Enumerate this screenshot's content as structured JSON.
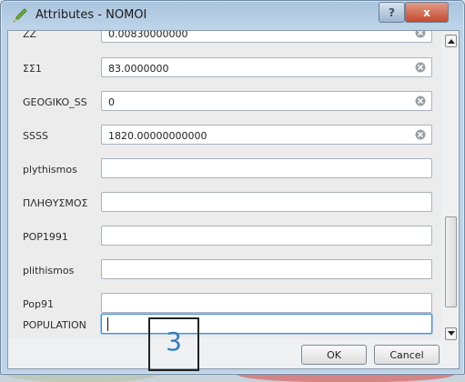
{
  "window": {
    "title": "Attributes - NOMOI",
    "help_glyph": "?",
    "close_glyph": "x"
  },
  "form": {
    "fields": [
      {
        "label": "ZZ",
        "value": "0.00830000000",
        "clear_icon": true
      },
      {
        "label": "ΣΣ1",
        "value": "83.0000000",
        "clear_icon": true
      },
      {
        "label": "GEOGIKO_SS",
        "value": "0",
        "clear_icon": true
      },
      {
        "label": "SSSS",
        "value": "1820.00000000000",
        "clear_icon": true
      },
      {
        "label": "plythismos",
        "value": "",
        "clear_icon": false
      },
      {
        "label": "ΠΛΗΘΥΣΜΟΣ",
        "value": "",
        "clear_icon": false
      },
      {
        "label": "POP1991",
        "value": "",
        "clear_icon": false
      },
      {
        "label": "plithismos",
        "value": "",
        "clear_icon": false
      },
      {
        "label": "Pop91",
        "value": "",
        "clear_icon": false
      },
      {
        "label": "POPULATION",
        "value": "",
        "clear_icon": false,
        "focused": true
      }
    ]
  },
  "buttons": {
    "ok_label": "OK",
    "cancel_label": "Cancel"
  },
  "annotation": {
    "label": "3",
    "color": "#2f7fbf"
  },
  "icons": {
    "app": "qgis-pencil-icon",
    "clear": "clear-field-icon",
    "scroll_up": "chevron-up-icon",
    "scroll_down": "chevron-down-icon"
  }
}
